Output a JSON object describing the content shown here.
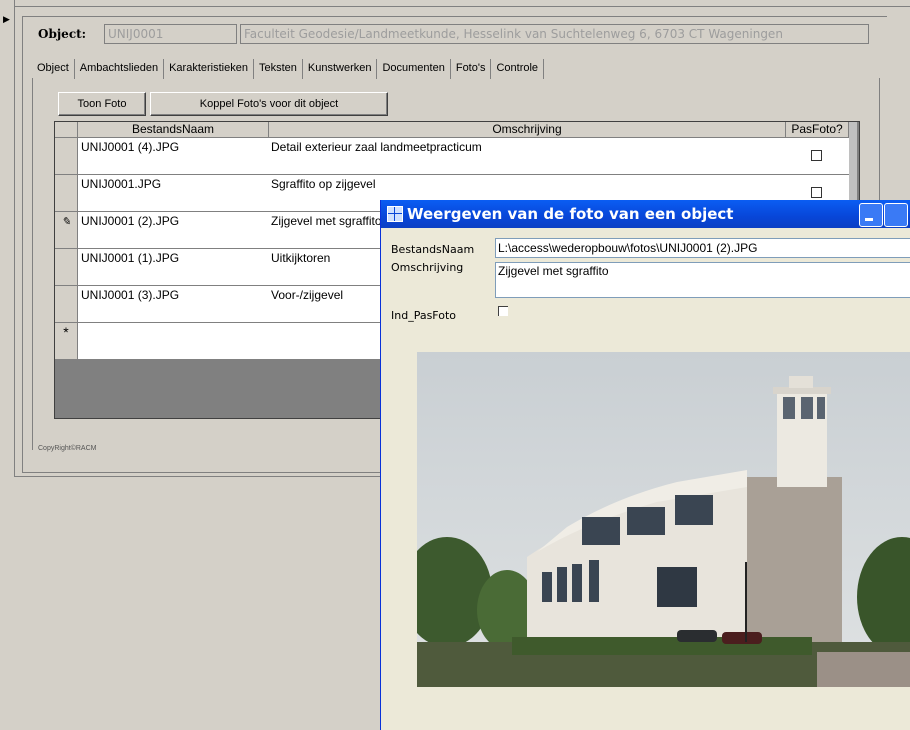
{
  "object_header": {
    "label": "Object:",
    "code": "UNIJ0001",
    "address": "Faculteit Geodesie/Landmeetkunde, Hesselink van Suchtelenweg 6, 6703 CT Wageningen"
  },
  "tabs": [
    {
      "label": "Object"
    },
    {
      "label": "Ambachtslieden"
    },
    {
      "label": "Karakteristieken"
    },
    {
      "label": "Teksten"
    },
    {
      "label": "Kunstwerken"
    },
    {
      "label": "Documenten"
    },
    {
      "label": "Foto's",
      "active": true
    },
    {
      "label": "Controle"
    }
  ],
  "buttons": {
    "toon_foto": "Toon Foto",
    "koppel": "Koppel Foto's voor dit object"
  },
  "grid": {
    "columns": [
      "BestandsNaam",
      "Omschrijving",
      "PasFoto?"
    ],
    "rows": [
      {
        "file": "UNIJ0001 (4).JPG",
        "desc": "Detail exterieur zaal landmeetpracticum",
        "selector": ""
      },
      {
        "file": "UNIJ0001.JPG",
        "desc": "Sgraffito op zijgevel",
        "selector": ""
      },
      {
        "file": "UNIJ0001 (2).JPG",
        "desc": "Zijgevel met sgraffito",
        "selector": "✎"
      },
      {
        "file": "UNIJ0001 (1).JPG",
        "desc": "Uitkijktoren",
        "selector": ""
      },
      {
        "file": "UNIJ0001 (3).JPG",
        "desc": "Voor-/zijgevel",
        "selector": ""
      }
    ],
    "new_row_marker": "*"
  },
  "copyright": "CopyRight©RACM",
  "dialog": {
    "title": "Weergeven van de foto van een object",
    "fields": {
      "bestandsnaam_label": "BestandsNaam",
      "bestandsnaam_value": "L:\\access\\wederopbouw\\fotos\\UNIJ0001 (2).JPG",
      "omschrijving_label": "Omschrijving",
      "omschrijving_value": "Zijgevel met sgraffito",
      "pasfoto_label": "Ind_PasFoto"
    }
  },
  "colors": {
    "titlebar": "#0846d8",
    "window_bg": "#d4d0c8",
    "dialog_bg": "#ece9d8"
  }
}
